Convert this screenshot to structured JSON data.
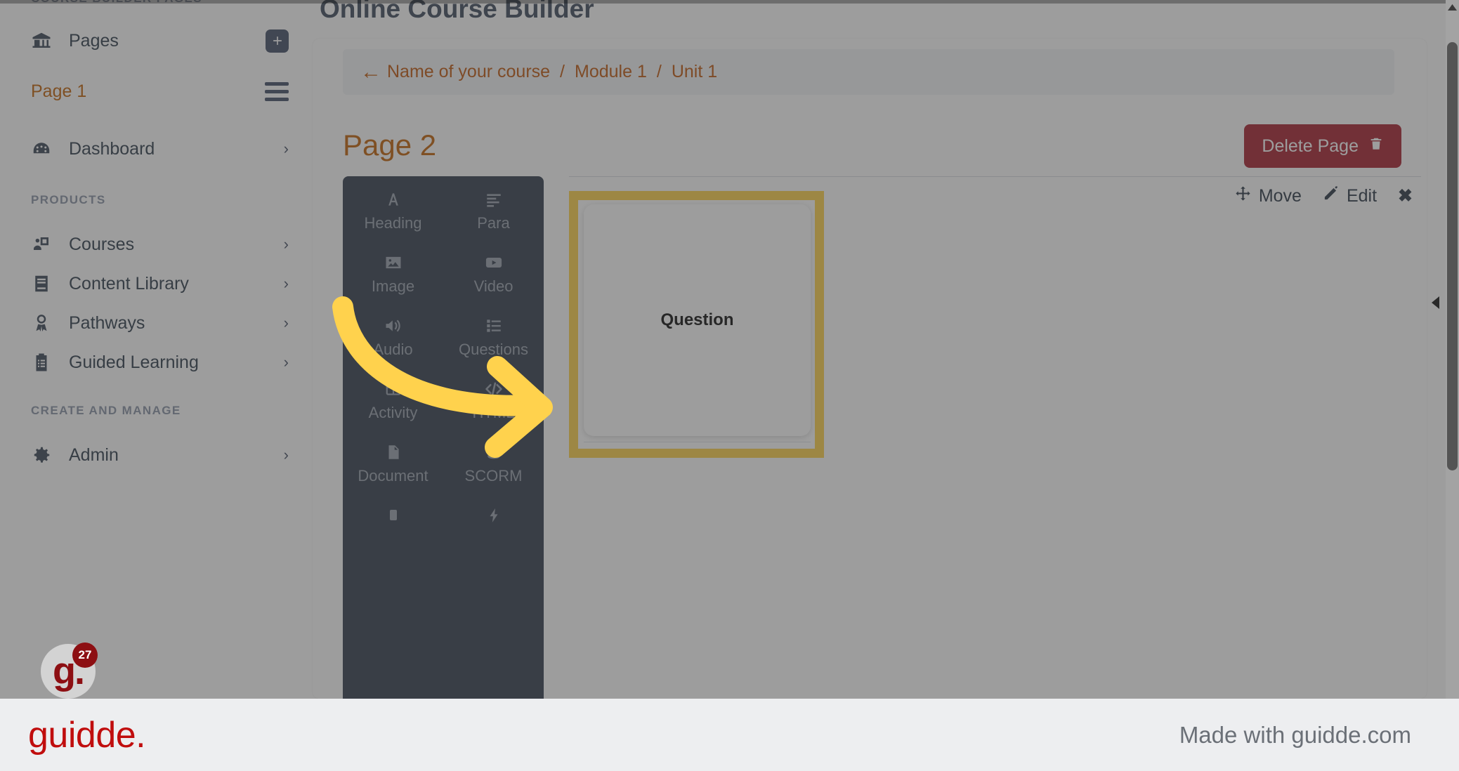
{
  "sidebar": {
    "section_label_top": "COURSE BUILDER PAGES",
    "pages_item": {
      "label": "Pages",
      "icon": "bank-icon",
      "action_icon": "plus-square-icon"
    },
    "page_item": {
      "label": "Page 1",
      "action_icon": "hamburger-icon"
    },
    "dashboard_item": {
      "label": "Dashboard",
      "icon": "gauge-icon",
      "chevron": "›"
    },
    "sections": [
      {
        "label": "PRODUCTS",
        "items": [
          {
            "label": "Courses",
            "icon": "presentation-user-icon",
            "chevron": "›"
          },
          {
            "label": "Content Library",
            "icon": "book-icon",
            "chevron": "›"
          },
          {
            "label": "Pathways",
            "icon": "award-icon",
            "chevron": "›"
          },
          {
            "label": "Guided Learning",
            "icon": "clipboard-list-icon",
            "chevron": "›"
          }
        ]
      },
      {
        "label": "CREATE AND MANAGE",
        "items": [
          {
            "label": "Admin",
            "icon": "gear-icon",
            "chevron": "›"
          }
        ]
      }
    ]
  },
  "main": {
    "app_title": "Online Course Builder",
    "breadcrumb": {
      "back_arrow": "←",
      "items": [
        "Name of your course",
        "Module 1",
        "Unit 1"
      ],
      "separator": "/"
    },
    "page_heading": "Page 2",
    "delete_button": {
      "label": "Delete Page",
      "icon": "trash-icon"
    }
  },
  "toolbar": {
    "items": [
      {
        "label": "Heading",
        "icon": "heading-a-icon"
      },
      {
        "label": "Para",
        "icon": "paragraph-lines-icon"
      },
      {
        "label": "Image",
        "icon": "image-icon"
      },
      {
        "label": "Video",
        "icon": "video-play-icon"
      },
      {
        "label": "Audio",
        "icon": "speaker-icon"
      },
      {
        "label": "Questions",
        "icon": "question-list-icon"
      },
      {
        "label": "Activity",
        "icon": "table-icon"
      },
      {
        "label": "HTML",
        "icon": "code-brackets-icon"
      },
      {
        "label": "Document",
        "icon": "file-icon"
      },
      {
        "label": "SCORM",
        "icon": "database-icon"
      },
      {
        "label": "",
        "icon": "square-icon"
      },
      {
        "label": "",
        "icon": "lightning-bolt-icon"
      }
    ]
  },
  "block": {
    "move_label": "Move",
    "edit_label": "Edit",
    "close_icon": "✖",
    "card_label": "Question"
  },
  "overlay_badge": {
    "count": "27",
    "letter": "g."
  },
  "footer": {
    "logo": "guidde.",
    "note": "Made with guidde.com"
  },
  "colors": {
    "accent_orange": "#c2650d",
    "delete_red": "#a82532",
    "highlight_yellow": "#ffd24d",
    "toolbar_dark": "#374151",
    "brand_red": "#c00d0d"
  }
}
